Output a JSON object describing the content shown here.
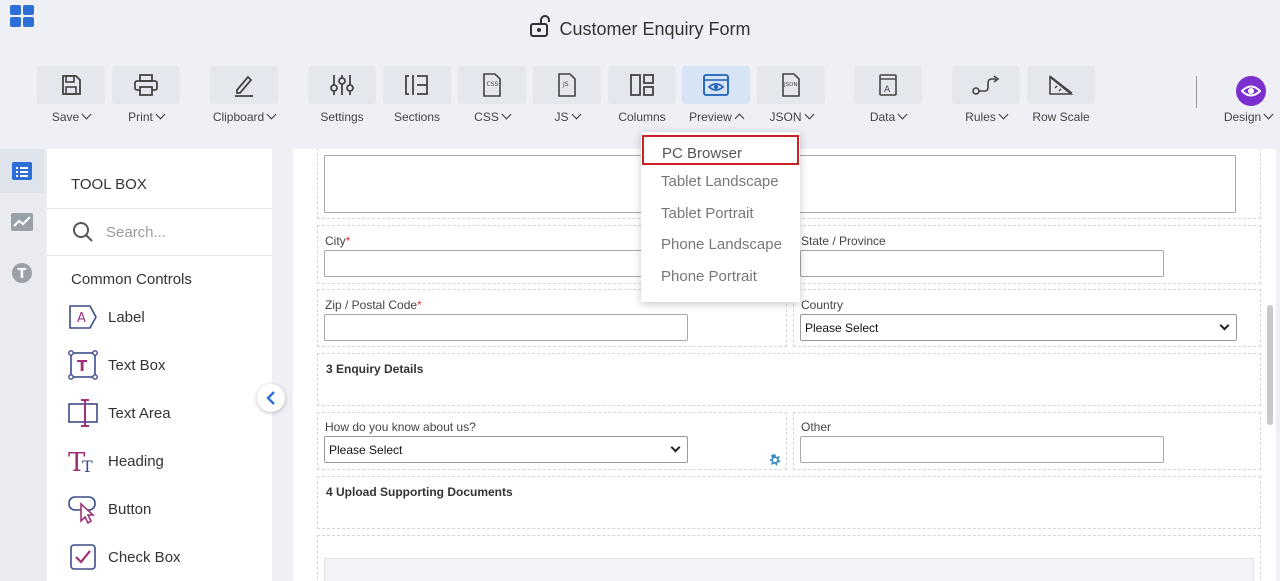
{
  "window": {
    "title": "Customer Enquiry Form"
  },
  "toolbar": {
    "items": [
      {
        "label": "Save",
        "icon": "save-icon",
        "dropdown": true
      },
      {
        "label": "Print",
        "icon": "print-icon",
        "dropdown": true
      },
      {
        "label": "Clipboard",
        "icon": "clipboard-icon",
        "dropdown": true
      },
      {
        "label": "Settings",
        "icon": "settings-icon",
        "dropdown": false
      },
      {
        "label": "Sections",
        "icon": "sections-icon",
        "dropdown": false
      },
      {
        "label": "CSS",
        "icon": "css-icon",
        "dropdown": true
      },
      {
        "label": "JS",
        "icon": "js-icon",
        "dropdown": true
      },
      {
        "label": "Columns",
        "icon": "columns-icon",
        "dropdown": false
      },
      {
        "label": "Preview",
        "icon": "preview-icon",
        "dropdown": true,
        "active": true
      },
      {
        "label": "JSON",
        "icon": "json-icon",
        "dropdown": true
      },
      {
        "label": "Data",
        "icon": "data-icon",
        "dropdown": true
      },
      {
        "label": "Rules",
        "icon": "rules-icon",
        "dropdown": true
      },
      {
        "label": "Row Scale",
        "icon": "row-scale-icon",
        "dropdown": false
      },
      {
        "label": "Design",
        "icon": "design-eye-icon",
        "dropdown": true
      }
    ],
    "accent_color": "#7b2fcf"
  },
  "preview_menu": {
    "items": [
      "PC Browser",
      "Tablet Landscape",
      "Tablet Portrait",
      "Phone Landscape",
      "Phone Portrait"
    ],
    "highlighted": "PC Browser"
  },
  "toolbox": {
    "title": "TOOL BOX",
    "search_placeholder": "Search...",
    "group": "Common Controls",
    "items": [
      "Label",
      "Text Box",
      "Text Area",
      "Heading",
      "Button",
      "Check Box"
    ]
  },
  "form": {
    "city_label": "City",
    "state_label": "State / Province",
    "zip_label": "Zip / Postal Code",
    "country_label": "Country",
    "country_value": "Please Select",
    "section3_title": "3 Enquiry Details",
    "how_label": "How do you know about us?",
    "how_value": "Please Select",
    "other_label": "Other",
    "section4_title": "4 Upload Supporting Documents",
    "required_mark": "*"
  }
}
